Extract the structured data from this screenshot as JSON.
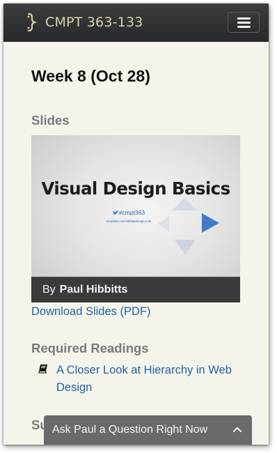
{
  "nav": {
    "brand": "CMPT 363-133",
    "logo_icon": "curly-brace-logo",
    "menu_icon": "hamburger-icon"
  },
  "page": {
    "title": "Week 8 (Oct 28)"
  },
  "slides": {
    "heading": "Slides",
    "thumbnail": {
      "title": "Visual Design Basics",
      "handle": "#cmpt363",
      "url": "cmpt363-133.hibbittsdesign.com",
      "caption_by": "By",
      "caption_author": "Paul Hibbitts"
    },
    "download_link": "Download Slides (PDF)"
  },
  "readings": {
    "heading": "Required Readings",
    "items": [
      {
        "label": "A Closer Look at Hierarchy in Web Design",
        "icon": "book-icon"
      }
    ]
  },
  "summary": {
    "heading_visible": "Su"
  },
  "ask_bar": {
    "label": "Ask Paul a Question Right Now",
    "icon": "chevron-up-icon"
  },
  "colors": {
    "nav_bg": "#2f3032",
    "brand_text": "#d9d3a8",
    "page_bg": "#f5f4ea",
    "link": "#1e62a8",
    "heading_gray": "#7a7a7a",
    "ask_bar_bg": "#6a6a6a"
  }
}
